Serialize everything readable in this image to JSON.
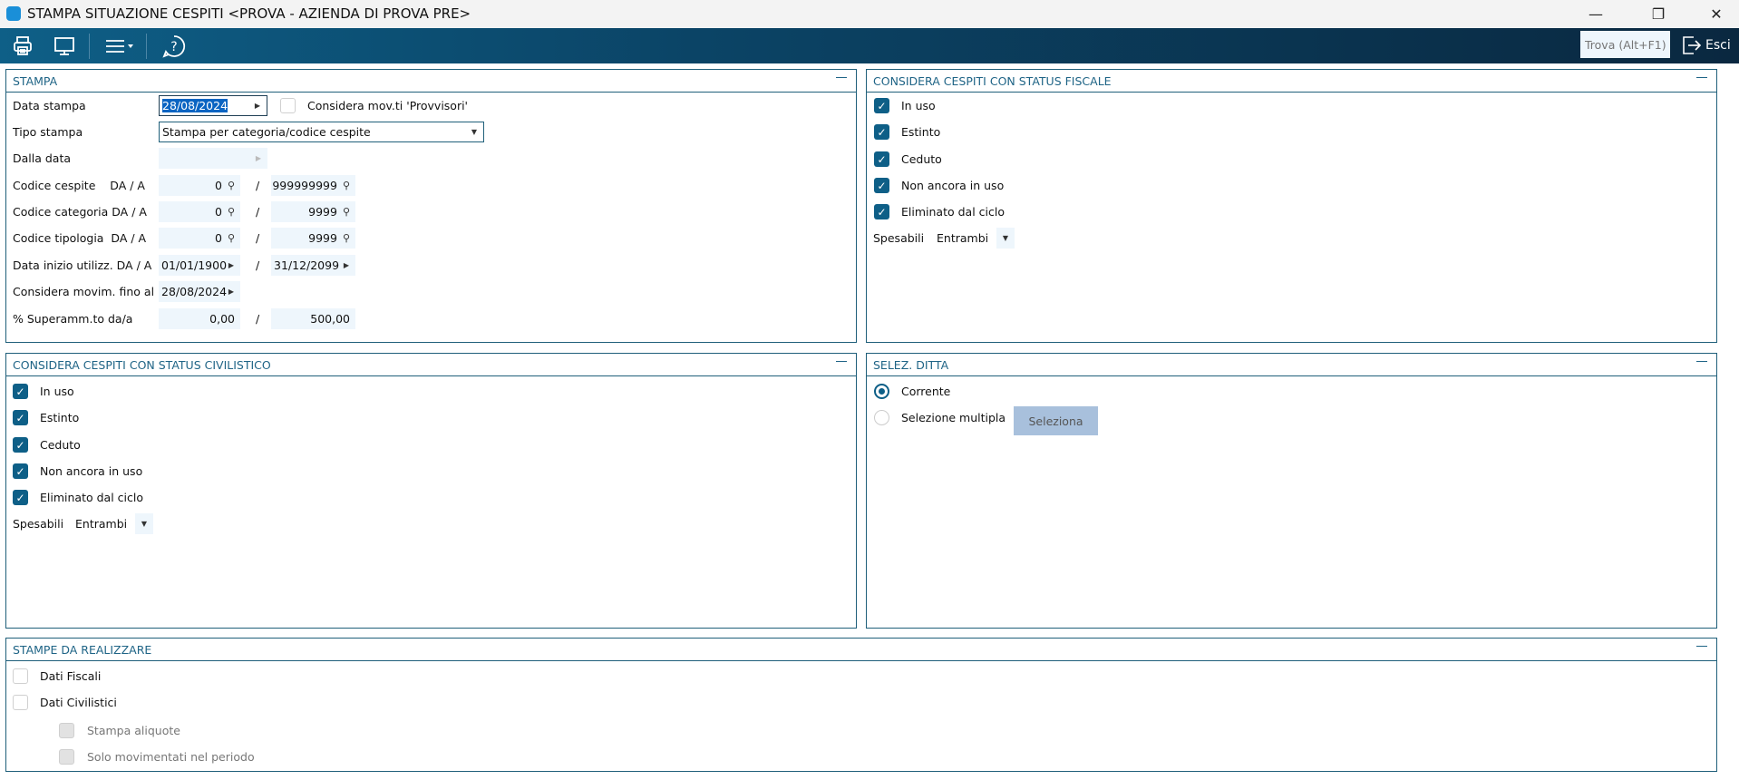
{
  "window": {
    "title": "STAMPA SITUAZIONE CESPITI <PROVA - AZIENDA DI PROVA PRE>",
    "minimize": "—",
    "restore": "❐",
    "close": "✕"
  },
  "toolbar": {
    "search_placeholder": "Trova (Alt+F1)",
    "exit_label": "Esci"
  },
  "stampa": {
    "title": "STAMPA",
    "data_stampa_label": "Data stampa",
    "data_stampa": "28/08/2024",
    "provvisori_label": "Considera mov.ti 'Provvisori'",
    "tipo_label": "Tipo stampa",
    "tipo_value": "Stampa per categoria/codice cespite",
    "dalla_data_label": "Dalla data",
    "cespite_label": "Codice cespite    DA / A",
    "cespite_da": "0",
    "cespite_a": "999999999",
    "categoria_label": "Codice categoria DA / A",
    "categoria_da": "0",
    "categoria_a": "9999",
    "tipologia_label": "Codice tipologia  DA / A",
    "tipologia_da": "0",
    "tipologia_a": "9999",
    "utilizz_label": "Data inizio utilizz. DA / A",
    "utilizz_da": "01/01/1900",
    "utilizz_a": "31/12/2099",
    "movim_label": "Considera movim. fino al",
    "movim_value": "28/08/2024",
    "superamm_label": "% Superamm.to da/a",
    "superamm_da": "0,00",
    "superamm_a": "500,00",
    "slash": "/"
  },
  "fiscale": {
    "title": "CONSIDERA CESPITI CON STATUS FISCALE",
    "items": [
      "In uso",
      "Estinto",
      "Ceduto",
      "Non ancora in uso",
      "Eliminato dal ciclo"
    ],
    "spesabili_label": "Spesabili",
    "spesabili_value": "Entrambi"
  },
  "civilistico": {
    "title": "CONSIDERA CESPITI CON STATUS CIVILISTICO",
    "items": [
      "In uso",
      "Estinto",
      "Ceduto",
      "Non ancora in uso",
      "Eliminato dal ciclo"
    ],
    "spesabili_label": "Spesabili",
    "spesabili_value": "Entrambi"
  },
  "ditta": {
    "title": "SELEZ. DITTA",
    "corrente": "Corrente",
    "multipla": "Selezione multipla",
    "seleziona": "Seleziona"
  },
  "stampe": {
    "title": "STAMPE DA REALIZZARE",
    "fiscali": "Dati Fiscali",
    "civilistici": "Dati Civilistici",
    "aliquote": "Stampa aliquote",
    "movimentati": "Solo movimentati nel periodo"
  }
}
